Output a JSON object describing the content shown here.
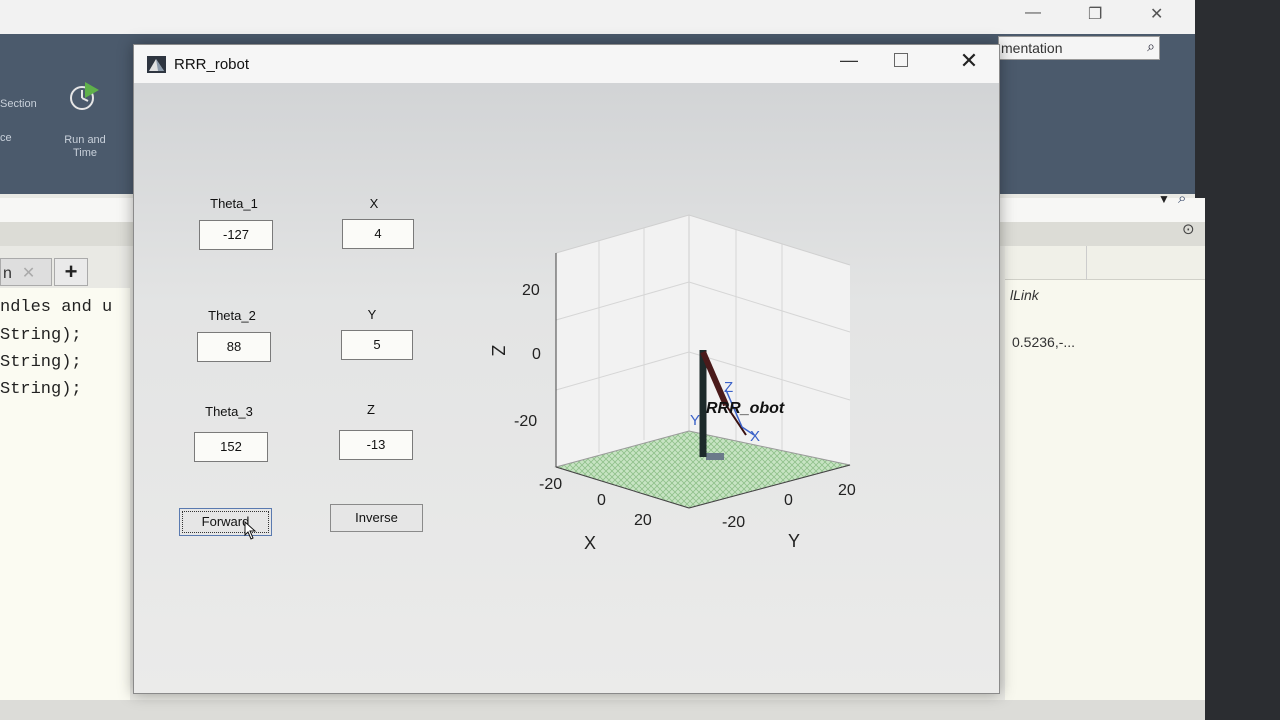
{
  "background": {
    "toolstrip": {
      "section_label": "Section",
      "partial_label": "ce",
      "run_time_label": "Run and Time"
    },
    "search_text": "mentation",
    "editor_lines": [
      "ndles and u",
      "String);",
      "String);",
      "String);"
    ],
    "right_panel": {
      "item_label": "lLink",
      "value_text": "0.5236,-..."
    }
  },
  "figure": {
    "title": "RRR_robot",
    "theta1": {
      "label": "Theta_1",
      "value": "-127"
    },
    "theta2": {
      "label": "Theta_2",
      "value": "88"
    },
    "theta3": {
      "label": "Theta_3",
      "value": "152"
    },
    "x": {
      "label": "X",
      "value": "4"
    },
    "y": {
      "label": "Y",
      "value": "5"
    },
    "z": {
      "label": "Z",
      "value": "-13"
    },
    "forward_label": "Forward",
    "inverse_label": "Inverse",
    "plot": {
      "z_axis_label": "Z",
      "x_axis_label": "X",
      "y_axis_label": "Y",
      "z_ticks": [
        "20",
        "0",
        "-20"
      ],
      "x_ticks": [
        "-20",
        "0",
        "20"
      ],
      "y_ticks": [
        "-20",
        "0",
        "20"
      ],
      "robot_name": "RRR_obot",
      "frame_labels": {
        "z": "Z",
        "y": "Y",
        "x": "X"
      }
    }
  }
}
